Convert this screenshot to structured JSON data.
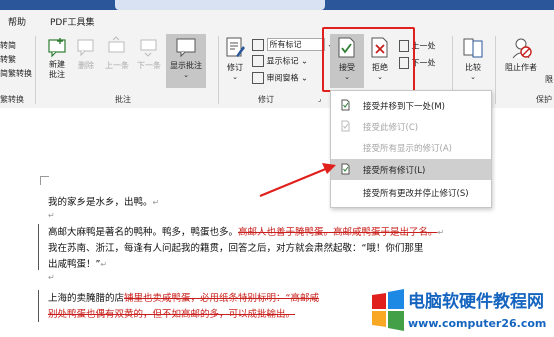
{
  "tabs": [
    "帮助",
    "PDF工具集"
  ],
  "left_cut": {
    "items": [
      "转简",
      "转繁",
      "简繁转换"
    ],
    "group": "繁转换"
  },
  "comments": {
    "new_label": "新建\n批注",
    "delete_label": "删除",
    "prev_label": "上一条",
    "next_label": "下一条",
    "show_label": "显示批注",
    "group": "批注"
  },
  "tracking": {
    "track_label": "修订",
    "markup_select": "所有标记",
    "show_markup": "显示标记",
    "reviewing_pane": "审阅窗格",
    "group": "修订"
  },
  "changes": {
    "accept_label": "接受",
    "reject_label": "拒绝",
    "prev_label": "上一处",
    "next_label": "下一处"
  },
  "compare": {
    "label": "比较"
  },
  "protect": {
    "label": "阻止作者",
    "group": "保护",
    "extra": "限"
  },
  "accept_menu": {
    "items": [
      {
        "label": "接受并移到下一处(M)",
        "state": "normal"
      },
      {
        "label": "接受此修订(C)",
        "state": "disabled"
      },
      {
        "label": "接受所有显示的修订(A)",
        "state": "disabled"
      },
      {
        "label": "接受所有修订(L)",
        "state": "highlighted"
      },
      {
        "label": "接受所有更改并停止修订(S)",
        "state": "normal"
      }
    ]
  },
  "document": {
    "p1": "我的家乡是水乡，出鸭。",
    "p2_normal": "高邮大麻鸭是著名的鸭种。鸭多，鸭蛋也多。",
    "p2_deleted": "高邮人也善于腌鸭蛋。高邮咸鸭蛋于是出了名。",
    "p3": "我在苏南、浙江，每逢有人问起我的籍贯，回答之后，对方就会肃然起敬：“哦！你们那里",
    "p4": "出咸鸭蛋！”",
    "p5_normal": "上海的卖腌腊的店",
    "p5_deleted": "铺里也卖咸鸭蛋，必用纸条特别标明：“高邮咸",
    "p6_deleted": "别处鸭蛋也偶有双黄的，但不如高邮的多，可以成批输出。"
  },
  "watermark": {
    "title": "电脑软硬件教程网",
    "url": "www.computer26.com"
  },
  "colors": {
    "accent": "#2b579a",
    "highlight_box": "#e0201c",
    "deletion": "#c8201c",
    "menu_highlight": "#cfcfcf"
  }
}
